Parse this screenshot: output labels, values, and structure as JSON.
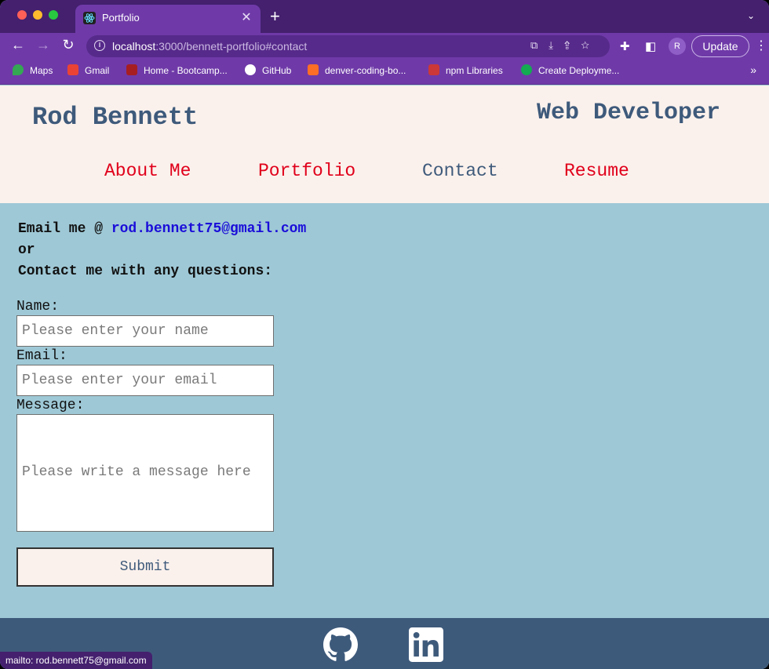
{
  "browser": {
    "tab_title": "Portfolio",
    "tab_close": "✕",
    "new_tab": "+",
    "tab_menu": "⌄",
    "url_host": "localhost",
    "url_rest": ":3000/bennett-portfolio#contact",
    "back": "←",
    "forward": "→",
    "reload": "↻",
    "update_label": "Update",
    "profile_initial": "R",
    "menu_dots": "⋮",
    "bookmarks_more": "»",
    "bookmarks": [
      {
        "label": "Maps",
        "icon": "maps-icon",
        "color": "#34a853"
      },
      {
        "label": "Gmail",
        "icon": "gmail-icon",
        "color": "#ea4335"
      },
      {
        "label": "Home - Bootcamp...",
        "icon": "bootcamp-icon",
        "color": "#a61e22"
      },
      {
        "label": "GitHub",
        "icon": "github-icon",
        "color": "#ffffff"
      },
      {
        "label": "denver-coding-bo...",
        "icon": "gitlab-icon",
        "color": "#fc6d26"
      },
      {
        "label": "npm Libraries",
        "icon": "npm-icon",
        "color": "#cb3837"
      },
      {
        "label": "Create Deployme...",
        "icon": "mongodb-icon",
        "color": "#13aa52"
      }
    ]
  },
  "site": {
    "name": "Rod Bennett",
    "role": "Web Developer",
    "nav": [
      {
        "label": "About Me",
        "active": false
      },
      {
        "label": "Portfolio",
        "active": false
      },
      {
        "label": "Contact",
        "active": true
      },
      {
        "label": "Resume",
        "active": false
      }
    ],
    "colors": {
      "accent": "#e0001b",
      "brand": "#3e5a7b",
      "page_bg": "#9ec8d6",
      "header_bg": "#fbf1ec"
    }
  },
  "contact": {
    "email_prefix": "Email me @ ",
    "email": "rod.bennett75@gmail.com",
    "or": "or",
    "questions": "Contact me with any questions:",
    "name_label": "Name:",
    "name_placeholder": "Please enter your name",
    "email_label": "Email:",
    "email_placeholder": "Please enter your email",
    "message_label": "Message:",
    "message_placeholder": "Please write a message here",
    "submit_label": "Submit"
  },
  "status_bar": "mailto: rod.bennett75@gmail.com"
}
